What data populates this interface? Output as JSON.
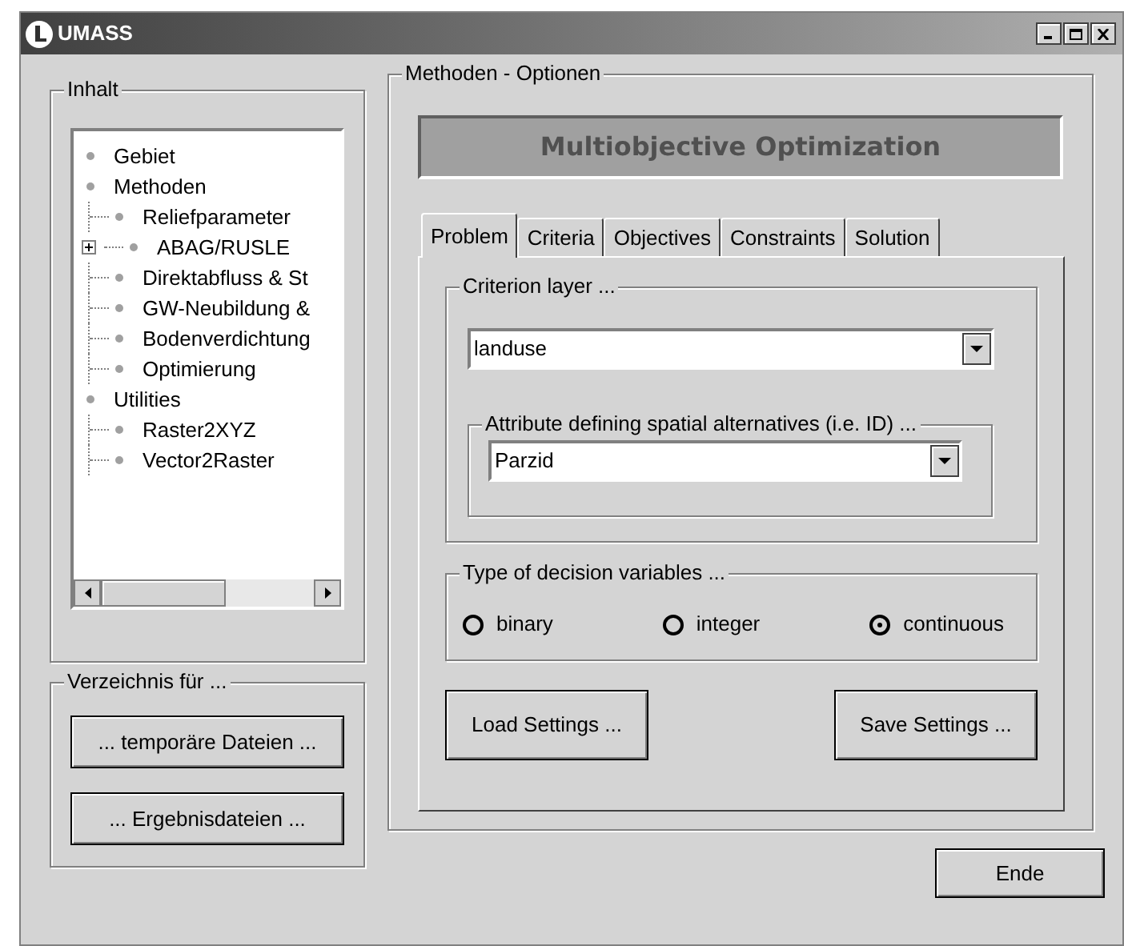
{
  "window": {
    "title": "UMASS"
  },
  "contents": {
    "title": "Inhalt",
    "tree": [
      {
        "label": "Gebiet"
      },
      {
        "label": "Methoden",
        "children": [
          {
            "label": "Reliefparameter",
            "collapsed": false
          },
          {
            "label": "ABAG/RUSLE",
            "collapsed": true
          },
          {
            "label": "Direktabfluss & St",
            "collapsed": false
          },
          {
            "label": "GW-Neubildung &",
            "collapsed": false
          },
          {
            "label": "Bodenverdichtung",
            "collapsed": false
          },
          {
            "label": "Optimierung",
            "collapsed": false
          }
        ]
      },
      {
        "label": "Utilities",
        "children": [
          {
            "label": "Raster2XYZ",
            "collapsed": false
          },
          {
            "label": "Vector2Raster",
            "collapsed": false
          }
        ]
      }
    ]
  },
  "directory": {
    "title": "Verzeichnis für ...",
    "buttons": [
      "... temporäre Dateien ...",
      "... Ergebnisdateien ..."
    ]
  },
  "options": {
    "title": "Methoden - Optionen",
    "header": "Multiobjective Optimization",
    "tabs": [
      {
        "label": "Problem",
        "selected": true
      },
      {
        "label": "Criteria",
        "selected": false
      },
      {
        "label": "Objectives",
        "selected": false
      },
      {
        "label": "Constraints",
        "selected": false
      },
      {
        "label": "Solution",
        "selected": false
      }
    ],
    "criterion_layer": {
      "title": "Criterion layer ...",
      "value": "landuse"
    },
    "attribute": {
      "title": "Attribute defining spatial alternatives  (i.e. ID) ...",
      "value": "Parzid"
    },
    "decision_type": {
      "title": "Type of decision variables ...",
      "options": [
        {
          "label": "binary",
          "selected": false
        },
        {
          "label": "integer",
          "selected": false
        },
        {
          "label": "continuous",
          "selected": true
        }
      ]
    },
    "buttons": [
      "Load Settings ...",
      "Save Settings ..."
    ]
  },
  "footer_button": "Ende"
}
